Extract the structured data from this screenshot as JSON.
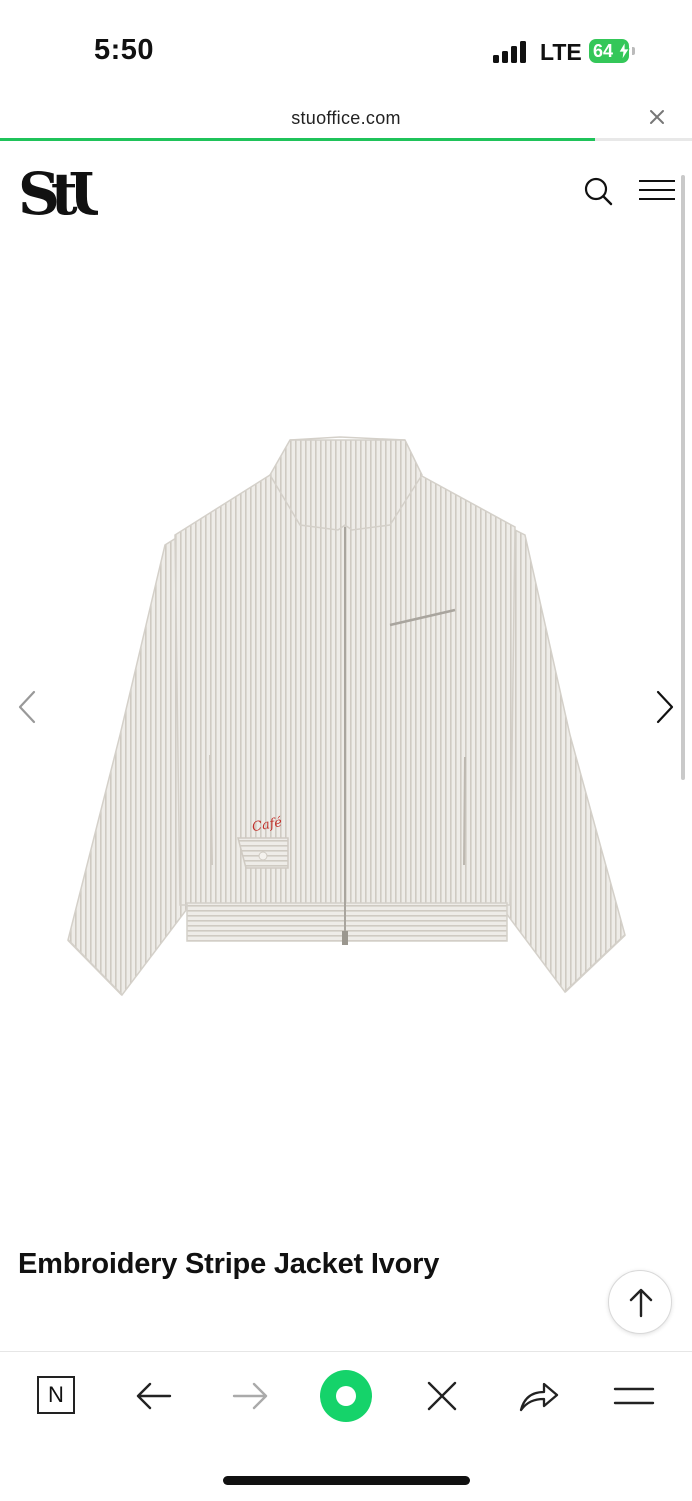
{
  "status_bar": {
    "time": "5:50",
    "network": "LTE",
    "battery": "64"
  },
  "browser": {
    "url": "stuoffice.com",
    "load_progress_percent": 86
  },
  "site": {
    "logo_text": "StU"
  },
  "product": {
    "title": "Embroidery Stripe Jacket Ivory",
    "embroidery_text": "Café"
  },
  "colors": {
    "accent_green": "#1fc35a",
    "battery_green": "#34c759",
    "embroidery_red": "#c0302a"
  },
  "toolbar": {
    "n_label": "N"
  }
}
